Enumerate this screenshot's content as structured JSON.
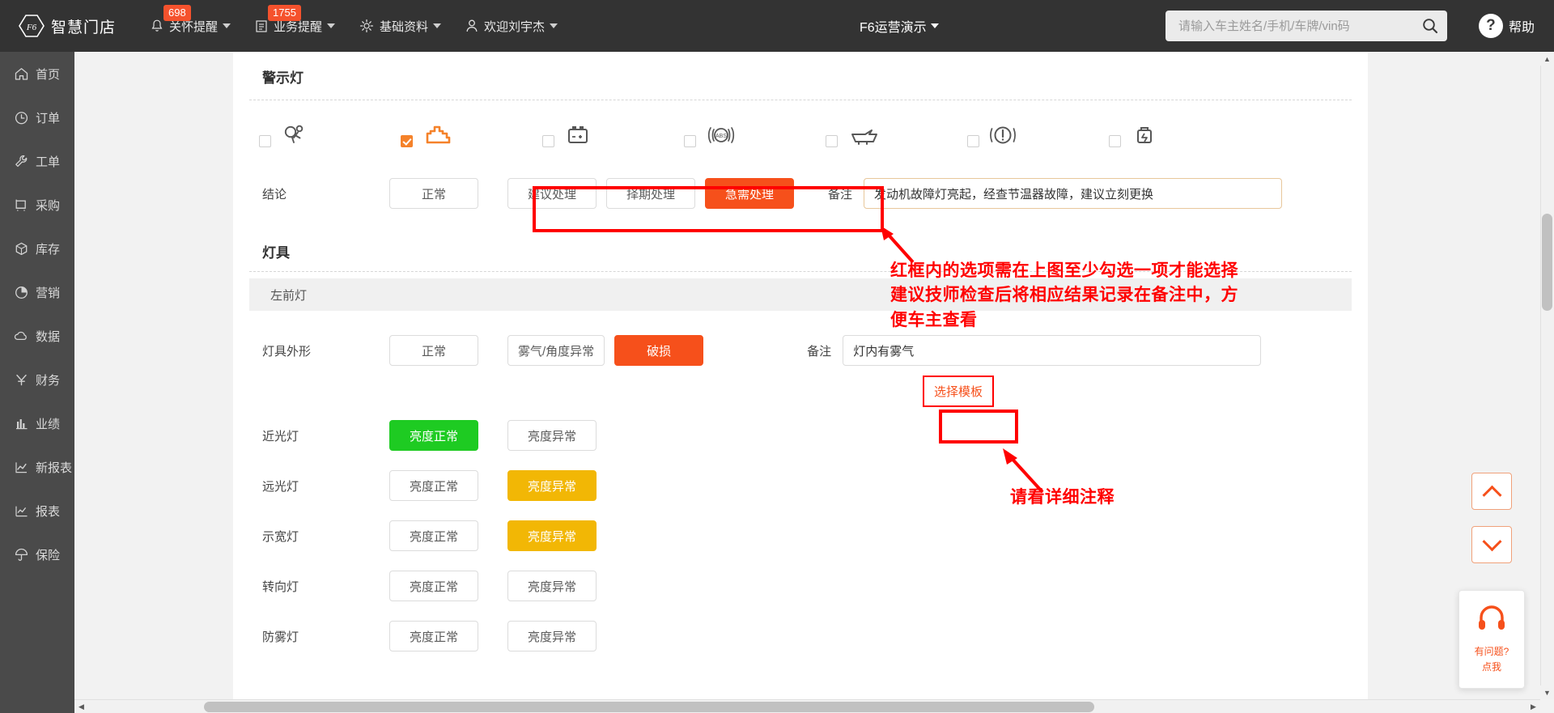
{
  "header": {
    "logo_text": "智慧门店",
    "nav": [
      {
        "label": "关怀提醒",
        "icon": "bell-icon",
        "badge": "698"
      },
      {
        "label": "业务提醒",
        "icon": "list-icon",
        "badge": "1755"
      },
      {
        "label": "基础资料",
        "icon": "gear-icon",
        "badge": ""
      },
      {
        "label": "欢迎刘宇杰",
        "icon": "user-icon",
        "badge": ""
      }
    ],
    "shop_name": "F6运营演示",
    "search_placeholder": "请输入车主姓名/手机/车牌/vin码",
    "search_value": "",
    "help_label": "帮助",
    "help_icon": "question-icon"
  },
  "sidebar": {
    "items": [
      {
        "label": "首页",
        "icon": "home-icon"
      },
      {
        "label": "订单",
        "icon": "clock-icon"
      },
      {
        "label": "工单",
        "icon": "wrench-icon"
      },
      {
        "label": "采购",
        "icon": "cart-icon"
      },
      {
        "label": "库存",
        "icon": "box-icon"
      },
      {
        "label": "营销",
        "icon": "pie-icon"
      },
      {
        "label": "数据",
        "icon": "cloud-icon"
      },
      {
        "label": "财务",
        "icon": "yuan-icon"
      },
      {
        "label": "业绩",
        "icon": "bar-chart-icon"
      },
      {
        "label": "新报表",
        "icon": "line-chart-icon"
      },
      {
        "label": "报表",
        "icon": "report-icon"
      },
      {
        "label": "保险",
        "icon": "umbrella-icon"
      }
    ]
  },
  "warning_section": {
    "title": "警示灯",
    "lamps": [
      {
        "icon": "seatbelt-icon",
        "checked": false,
        "active": false
      },
      {
        "icon": "engine-check-icon",
        "checked": true,
        "active": true
      },
      {
        "icon": "battery-icon",
        "checked": false,
        "active": false
      },
      {
        "icon": "abs-icon",
        "checked": false,
        "active": false
      },
      {
        "icon": "oil-can-icon",
        "checked": false,
        "active": false
      },
      {
        "icon": "exclamation-circle-icon",
        "checked": false,
        "active": false
      },
      {
        "icon": "brake-fluid-icon",
        "checked": false,
        "active": false
      }
    ],
    "conclusion_label": "结论",
    "conclusion_options": [
      {
        "label": "正常",
        "state": "default"
      },
      {
        "label": "建议处理",
        "state": "default"
      },
      {
        "label": "择期处理",
        "state": "default"
      },
      {
        "label": "急需处理",
        "state": "orange"
      }
    ],
    "remark_label": "备注",
    "remark_value": "发动机故障灯亮起，经查节温器故障，建议立刻更换"
  },
  "lamp_section": {
    "title": "灯具",
    "group_label": "左前灯",
    "rows": [
      {
        "label": "灯具外形",
        "options": [
          {
            "label": "正常",
            "state": "default"
          },
          {
            "label": "雾气/角度异常",
            "state": "default"
          },
          {
            "label": "破损",
            "state": "orange"
          }
        ],
        "remark_label": "备注",
        "remark_value": "灯内有雾气",
        "has_remark": true,
        "has_template_link": true,
        "template_link": "选择模板"
      },
      {
        "label": "近光灯",
        "options": [
          {
            "label": "亮度正常",
            "state": "green"
          },
          {
            "label": "亮度异常",
            "state": "default"
          }
        ],
        "has_remark": false
      },
      {
        "label": "远光灯",
        "options": [
          {
            "label": "亮度正常",
            "state": "default"
          },
          {
            "label": "亮度异常",
            "state": "yellow"
          }
        ],
        "has_remark": false
      },
      {
        "label": "示宽灯",
        "options": [
          {
            "label": "亮度正常",
            "state": "default"
          },
          {
            "label": "亮度异常",
            "state": "yellow"
          }
        ],
        "has_remark": false
      },
      {
        "label": "转向灯",
        "options": [
          {
            "label": "亮度正常",
            "state": "default"
          },
          {
            "label": "亮度异常",
            "state": "default"
          }
        ],
        "has_remark": false
      },
      {
        "label": "防雾灯",
        "options": [
          {
            "label": "亮度正常",
            "state": "default"
          },
          {
            "label": "亮度异常",
            "state": "default"
          }
        ],
        "has_remark": false
      }
    ]
  },
  "annotations": {
    "note1": "红框内的选项需在上图至少勾选一项才能选择\n建议技师检查后将相应结果记录在备注中，方\n便车主查看",
    "note2": "请看详细注释",
    "color": "#ff0000"
  },
  "chat_widget": {
    "line1": "有问题?",
    "line2": "点我",
    "icon": "headset-icon"
  },
  "scroll_buttons": {
    "up": "scroll-up-icon",
    "down": "scroll-down-icon"
  }
}
